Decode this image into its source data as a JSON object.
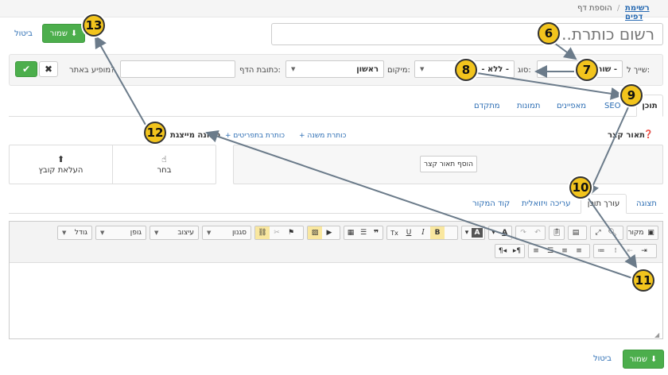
{
  "breadcrumb": {
    "link": "רשימת דפים",
    "sep": "/",
    "current": "הוספת דף"
  },
  "actions": {
    "save": "שמור",
    "cancel": "ביטול"
  },
  "title_placeholder": "רשום כותרת..",
  "filters": {
    "parent_label": "שייך ל:",
    "parent_value": "- שורש -",
    "type_label": "סוג:",
    "type_value": "- ללא -",
    "location_label": "מיקום:",
    "location_value": "ראשון",
    "address_label": "כתובת הדף:",
    "visible_label": "מופיע באתר?"
  },
  "tabs": [
    "תוכן",
    "SEO",
    "מאפיינים",
    "תמונות",
    "מתקדם"
  ],
  "summary": {
    "label": "תאור קצר",
    "add_sub": "+ כותרת משנה",
    "add_chapters": "+ כותרת בתפריטים",
    "add_btn": "הוסף תאור קצר"
  },
  "image": {
    "label": "תמונה מייצגת",
    "choose": "בחר",
    "upload": "העלאת קובץ"
  },
  "editor_tabs": [
    "תצוגה",
    "עורך תוכן",
    "עריכה ויזואלית",
    "קוד המקור"
  ],
  "toolbar": {
    "source": "מקור",
    "combos": [
      "סגנון",
      "עיצוב",
      "גופן",
      "גודל"
    ],
    "buttons_row1": [
      "B",
      "I",
      "U",
      "Tx"
    ]
  },
  "markers": [
    "6",
    "7",
    "8",
    "9",
    "10",
    "11",
    "12",
    "13"
  ],
  "colors": {
    "green": "#4cae4c",
    "marker": "#f2c41d",
    "link": "#2a6cb3"
  }
}
